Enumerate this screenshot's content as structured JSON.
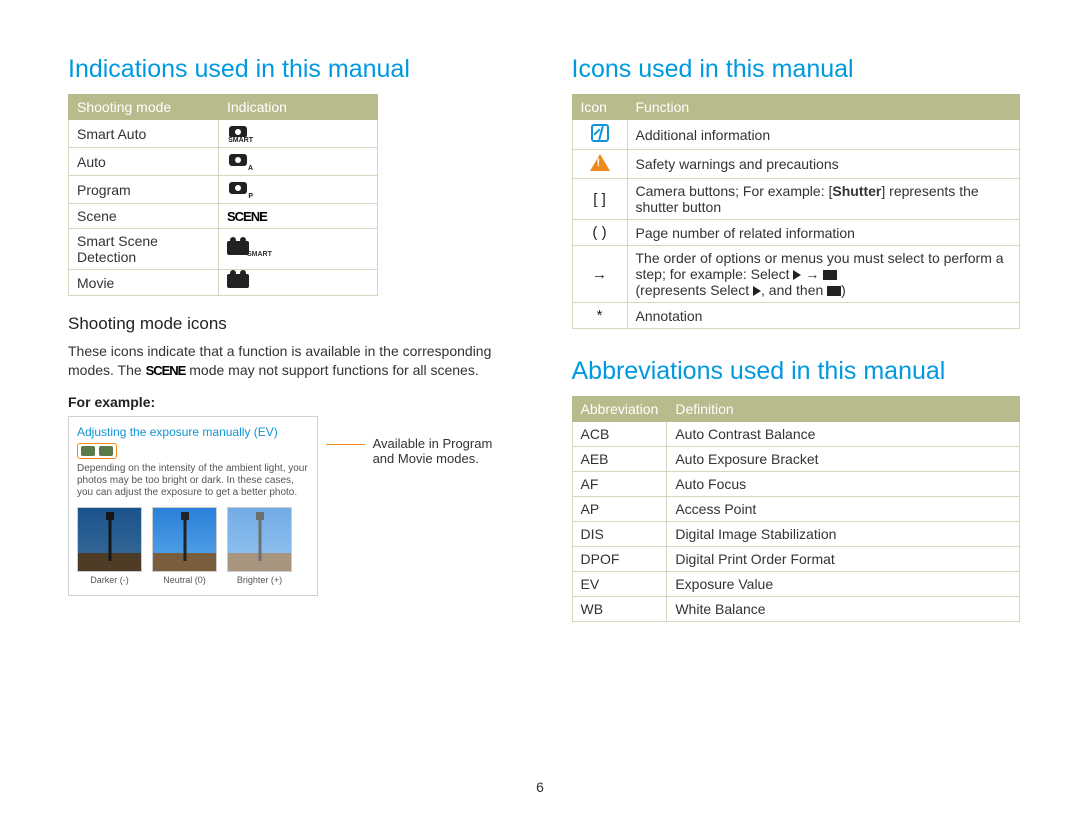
{
  "page_number": "6",
  "left": {
    "heading": "Indications used in this manual",
    "table_headers": [
      "Shooting mode",
      "Indication"
    ],
    "rows": [
      {
        "mode": "Smart Auto",
        "icon": "camera",
        "sub": "SMART"
      },
      {
        "mode": "Auto",
        "icon": "camera",
        "sub": "A"
      },
      {
        "mode": "Program",
        "icon": "camera",
        "sub": "P"
      },
      {
        "mode": "Scene",
        "icon": "scene-text",
        "text": "SCENE"
      },
      {
        "mode": "Smart Scene Detection",
        "icon": "movie",
        "sub": "SMART"
      },
      {
        "mode": "Movie",
        "icon": "movie",
        "sub": ""
      }
    ],
    "subheading": "Shooting mode icons",
    "para_a": "These icons indicate that a function is available in the corresponding modes. The ",
    "para_b": " mode may not support functions for all scenes.",
    "scene_inline": "SCENE",
    "for_example": "For example:",
    "example": {
      "title": "Adjusting the exposure manually (EV)",
      "desc": "Depending on the intensity of the ambient light, your photos may be too bright or dark. In these cases, you can adjust the exposure to get a better photo.",
      "thumbs": [
        {
          "label": "Darker (-)",
          "variant": "dark"
        },
        {
          "label": "Neutral (0)",
          "variant": ""
        },
        {
          "label": "Brighter (+)",
          "variant": "bright"
        }
      ],
      "callout": "Available in Program and Movie modes."
    }
  },
  "right": {
    "icons_heading": "Icons used in this manual",
    "icons_headers": [
      "Icon",
      "Function"
    ],
    "icons_rows": [
      {
        "icon": "info",
        "text": "Additional information"
      },
      {
        "icon": "warn",
        "text": "Safety warnings and precautions"
      },
      {
        "icon": "brackets",
        "glyph": "[  ]",
        "text_a": "Camera buttons; For example: [",
        "bold": "Shutter",
        "text_b": "] represents the shutter button"
      },
      {
        "icon": "parens",
        "glyph": "(  )",
        "text": "Page number of related information"
      },
      {
        "icon": "arrow",
        "glyph": "→",
        "text_a": "The order of options or menus you must select to perform a step; for example: Select ",
        "text_b": "(represents Select ",
        "text_c": ", and then ",
        "text_d": ")"
      },
      {
        "icon": "star",
        "glyph": "*",
        "text": "Annotation"
      }
    ],
    "abbr_heading": "Abbreviations used in this manual",
    "abbr_headers": [
      "Abbreviation",
      "Definition"
    ],
    "abbr_rows": [
      {
        "abbr": "ACB",
        "def": "Auto Contrast Balance"
      },
      {
        "abbr": "AEB",
        "def": "Auto Exposure Bracket"
      },
      {
        "abbr": "AF",
        "def": "Auto Focus"
      },
      {
        "abbr": "AP",
        "def": "Access Point"
      },
      {
        "abbr": "DIS",
        "def": "Digital Image Stabilization"
      },
      {
        "abbr": "DPOF",
        "def": "Digital Print Order Format"
      },
      {
        "abbr": "EV",
        "def": "Exposure Value"
      },
      {
        "abbr": "WB",
        "def": "White Balance"
      }
    ]
  }
}
